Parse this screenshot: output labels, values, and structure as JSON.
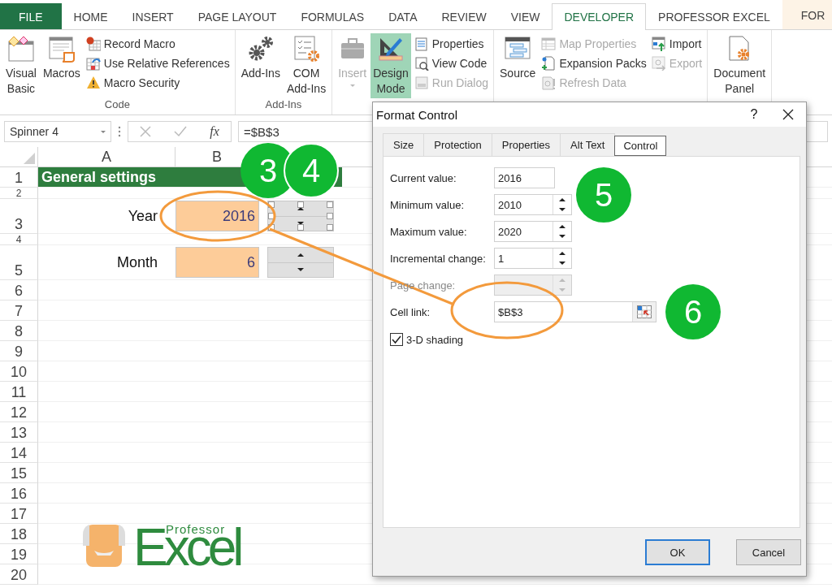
{
  "ribbon_tabs": [
    {
      "label": "FILE",
      "kind": "file",
      "selected": false
    },
    {
      "label": "HOME",
      "kind": "tab",
      "selected": false
    },
    {
      "label": "INSERT",
      "kind": "tab",
      "selected": false
    },
    {
      "label": "PAGE LAYOUT",
      "kind": "tab",
      "selected": false
    },
    {
      "label": "FORMULAS",
      "kind": "tab",
      "selected": false
    },
    {
      "label": "DATA",
      "kind": "tab",
      "selected": false
    },
    {
      "label": "REVIEW",
      "kind": "tab",
      "selected": false
    },
    {
      "label": "VIEW",
      "kind": "tab",
      "selected": false
    },
    {
      "label": "DEVELOPER",
      "kind": "tab",
      "selected": true
    },
    {
      "label": "PROFESSOR EXCEL",
      "kind": "tab",
      "selected": false
    },
    {
      "label": "FOR",
      "kind": "addin",
      "selected": false
    }
  ],
  "ribbon_groups": [
    {
      "label": "Code",
      "large": [
        {
          "label": "Visual Basic",
          "disabled": false,
          "on": false,
          "dropdown": false
        },
        {
          "label": "Macros",
          "disabled": false,
          "on": false,
          "dropdown": false
        }
      ],
      "small": [
        [
          {
            "label": "Record Macro",
            "disabled": false
          },
          {
            "label": "Use Relative References",
            "disabled": false
          },
          {
            "label": "Macro Security",
            "disabled": false
          }
        ]
      ]
    },
    {
      "label": "Add-Ins",
      "large": [
        {
          "label": "Add-Ins",
          "disabled": false,
          "on": false,
          "dropdown": false
        },
        {
          "label": "COM Add-Ins",
          "disabled": false,
          "on": false,
          "dropdown": false
        }
      ]
    },
    {
      "large": [
        {
          "label": "Insert",
          "disabled": true,
          "on": false,
          "dropdown": true
        },
        {
          "label": "Design Mode",
          "disabled": false,
          "on": true,
          "dropdown": false
        }
      ],
      "small": [
        [
          {
            "label": "Properties",
            "disabled": false
          },
          {
            "label": "View Code",
            "disabled": false
          },
          {
            "label": "Run Dialog",
            "disabled": true
          }
        ]
      ]
    },
    {
      "large": [
        {
          "label": "Source",
          "disabled": false,
          "on": false,
          "dropdown": false
        }
      ],
      "small": [
        [
          {
            "label": "Map Properties",
            "disabled": true
          },
          {
            "label": "Expansion Packs",
            "disabled": false
          },
          {
            "label": "Refresh Data",
            "disabled": true
          }
        ],
        [
          {
            "label": "Import",
            "disabled": false
          },
          {
            "label": "Export",
            "disabled": true
          }
        ]
      ]
    },
    {
      "large": [
        {
          "label": "Document Panel",
          "disabled": false,
          "on": false,
          "dropdown": false
        }
      ]
    }
  ],
  "formula_bar": {
    "name_box": "Spinner 4",
    "function_label": "fx",
    "formula": "=$B$3"
  },
  "sheet": {
    "columns": [
      "A",
      "B"
    ],
    "rows": [
      {
        "number": "1",
        "kind": "normal",
        "title": "General settings"
      },
      {
        "number": "2",
        "kind": "short"
      },
      {
        "number": "3",
        "kind": "tall",
        "label": "Year",
        "value": "2016",
        "spinner": {
          "selected": true
        }
      },
      {
        "number": "4",
        "kind": "short"
      },
      {
        "number": "5",
        "kind": "tall",
        "label": "Month",
        "value": "6",
        "spinner": {
          "selected": false
        }
      },
      {
        "number": "6",
        "kind": "normal"
      },
      {
        "number": "7",
        "kind": "normal"
      },
      {
        "number": "8",
        "kind": "normal"
      },
      {
        "number": "9",
        "kind": "normal"
      },
      {
        "number": "10",
        "kind": "normal"
      },
      {
        "number": "11",
        "kind": "normal"
      },
      {
        "number": "12",
        "kind": "normal"
      },
      {
        "number": "13",
        "kind": "normal"
      },
      {
        "number": "14",
        "kind": "normal"
      },
      {
        "number": "15",
        "kind": "normal"
      },
      {
        "number": "16",
        "kind": "normal"
      },
      {
        "number": "17",
        "kind": "normal"
      },
      {
        "number": "18",
        "kind": "normal"
      },
      {
        "number": "19",
        "kind": "normal"
      },
      {
        "number": "20",
        "kind": "normal"
      }
    ],
    "logo": {
      "small": "Professor",
      "large": "Excel"
    }
  },
  "dialog": {
    "title": "Format Control",
    "help": "?",
    "tabs": [
      {
        "label": "Size",
        "selected": false
      },
      {
        "label": "Protection",
        "selected": false
      },
      {
        "label": "Properties",
        "selected": false
      },
      {
        "label": "Alt Text",
        "selected": false
      },
      {
        "label": "Control",
        "selected": true
      }
    ],
    "fields": [
      {
        "label": "Current value:",
        "value": "2016",
        "kind": "text",
        "disabled": false
      },
      {
        "label": "Minimum value:",
        "value": "2010",
        "kind": "spin",
        "disabled": false
      },
      {
        "label": "Maximum value:",
        "value": "2020",
        "kind": "spin",
        "disabled": false
      },
      {
        "label": "Incremental change:",
        "value": "1",
        "kind": "spin",
        "disabled": false
      },
      {
        "label": "Page change:",
        "kind": "spin",
        "disabled": true
      },
      {
        "label": "Cell link:",
        "value": "$B$3",
        "kind": "ref",
        "disabled": false
      }
    ],
    "checkbox": {
      "label": "3-D shading",
      "checked": true
    },
    "buttons": [
      {
        "label": "OK",
        "default": true
      },
      {
        "label": "Cancel",
        "default": false
      }
    ]
  },
  "markers": [
    {
      "number": "3"
    },
    {
      "number": "4"
    },
    {
      "number": "5"
    },
    {
      "number": "6"
    }
  ]
}
